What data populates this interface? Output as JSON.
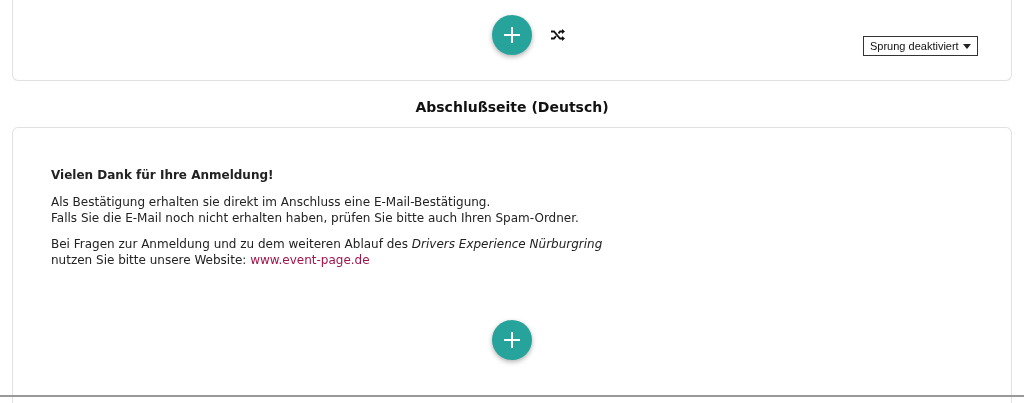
{
  "top_card": {
    "jump_select": {
      "value": "Sprung deaktiviert"
    }
  },
  "section": {
    "title": "Abschlußseite (Deutsch)",
    "heading": "Vielen Dank für Ihre Anmeldung!",
    "paragraphs": [
      {
        "lines": [
          {
            "text": "Als Bestätigung erhalten sie direkt im Anschluss eine E-Mail-Bestätigung."
          },
          {
            "text": "Falls Sie die E-Mail noch nicht erhalten haben, prüfen Sie bitte auch Ihren Spam-Ordner."
          }
        ]
      },
      {
        "lines": [
          {
            "text": "Bei Fragen zur Anmeldung und zu dem weiteren Ablauf des *Drivers Experience Nürburgring*"
          },
          {
            "text": "nutzen Sie bitte unsere Website: ",
            "link": "www.event-page.de"
          }
        ]
      }
    ]
  }
}
